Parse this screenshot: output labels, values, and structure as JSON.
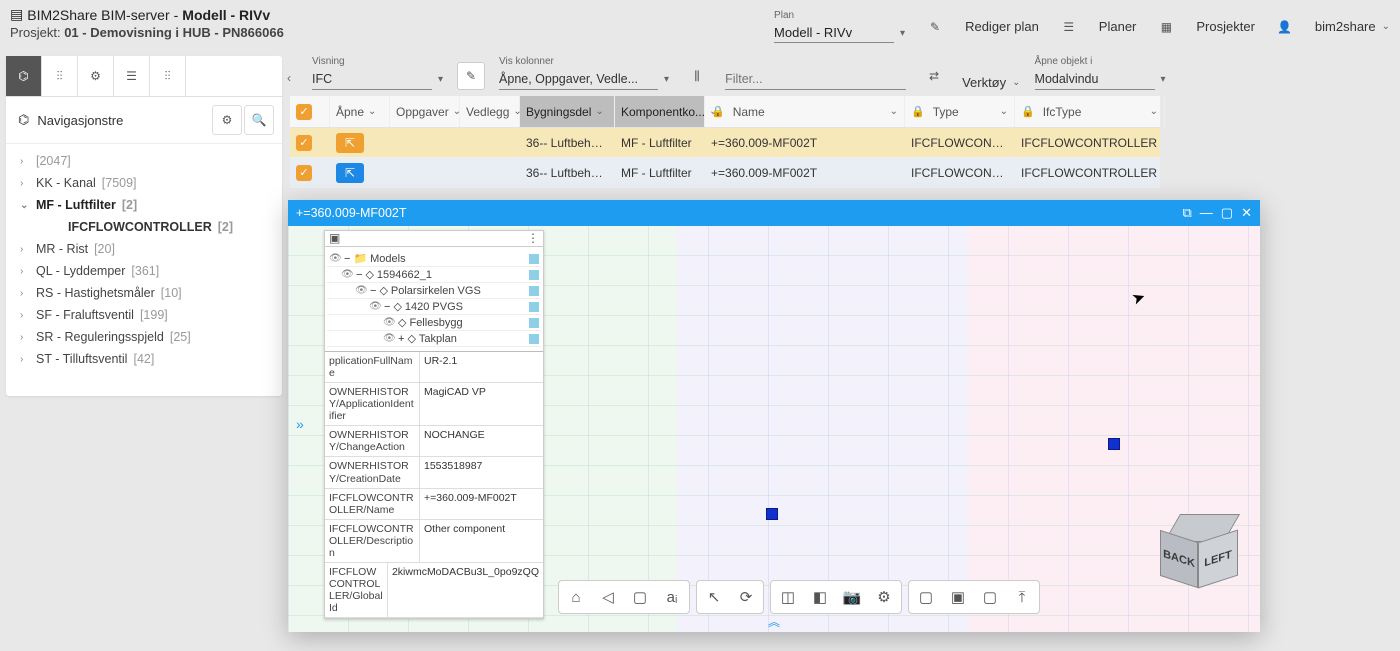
{
  "header": {
    "app_icon": "▤",
    "app_name": "BIM2Share BIM-server",
    "dash": " - ",
    "model_label": "Modell - RIVv",
    "sub_prefix": "Prosjekt: ",
    "sub_value": "01 - Demovisning i HUB - PN866066",
    "plan_label": "Plan",
    "plan_value": "Modell - RIVv",
    "edit_plan": "Rediger plan",
    "plans": "Planer",
    "projects": "Prosjekter",
    "user": "bim2share"
  },
  "sidebar": {
    "title": "Navigasjonstre",
    "items": [
      {
        "label": "[2047]",
        "count": ""
      },
      {
        "label": "KK - Kanal",
        "count": "[7509]"
      },
      {
        "label": "MF - Luftfilter",
        "count": "[2]",
        "expanded": true,
        "selected": true
      },
      {
        "label": "MR - Rist",
        "count": "[20]"
      },
      {
        "label": "QL - Lyddemper",
        "count": "[361]"
      },
      {
        "label": "RS - Hastighetsmåler",
        "count": "[10]"
      },
      {
        "label": "SF - Fraluftsventil",
        "count": "[199]"
      },
      {
        "label": "SR - Reguleringsspjeld",
        "count": "[25]"
      },
      {
        "label": "ST - Tilluftsventil",
        "count": "[42]"
      }
    ],
    "leaf": {
      "label": "IFCFLOWCONTROLLER",
      "count": "[2]"
    }
  },
  "toolbar": {
    "visning_label": "Visning",
    "visning_value": "IFC",
    "viskol_label": "Vis kolonner",
    "viskol_value": "Åpne, Oppgaver, Vedle...",
    "filter_placeholder": "Filter...",
    "verktoy": "Verktøy",
    "open_label": "Åpne objekt i",
    "open_value": "Modalvindu"
  },
  "table": {
    "cols": {
      "apne": "Åpne",
      "oppgaver": "Oppgaver",
      "vedlegg": "Vedlegg",
      "bygningsdel": "Bygningsdel",
      "komponentko": "Komponentko...",
      "name": "Name",
      "type": "Type",
      "ifctype": "IfcType"
    },
    "rows": [
      {
        "bygningsdel": "36-- Luftbehandling",
        "komp": "MF - Luftfilter",
        "name": "+=360.009-MF002T",
        "type": "IFCFLOWCONTR...",
        "ifctype": "IFCFLOWCONTROLLER",
        "badge": "y"
      },
      {
        "bygningsdel": "36-- Luftbehandling",
        "komp": "MF - Luftfilter",
        "name": "+=360.009-MF002T",
        "type": "IFCFLOWCONTR...",
        "ifctype": "IFCFLOWCONTROLLER",
        "badge": "b"
      }
    ]
  },
  "modal": {
    "title": "+=360.009-MF002T",
    "tree": [
      "Models",
      "1594662_1",
      "Polarsirkelen VGS",
      "1420 PVGS",
      "Fellesbygg",
      "Takplan"
    ],
    "props": [
      {
        "k": "pplicationFullName",
        "v": "UR-2.1"
      },
      {
        "k": "OWNERHISTORY/ApplicationIdentifier",
        "v": "MagiCAD VP"
      },
      {
        "k": "OWNERHISTORY/ChangeAction",
        "v": "NOCHANGE"
      },
      {
        "k": "OWNERHISTORY/CreationDate",
        "v": "1553518987"
      },
      {
        "k": "IFCFLOWCONTROLLER/Name",
        "v": "+=360.009-MF002T"
      },
      {
        "k": "IFCFLOWCONTROLLER/Description",
        "v": "Other component"
      },
      {
        "k": "IFCFLOWCONTROLLER/GlobalId",
        "v": "2kiwmcMoDACBu3L_0po9zQQ"
      }
    ],
    "cube": {
      "back": "BACK",
      "left": "LEFT"
    }
  }
}
